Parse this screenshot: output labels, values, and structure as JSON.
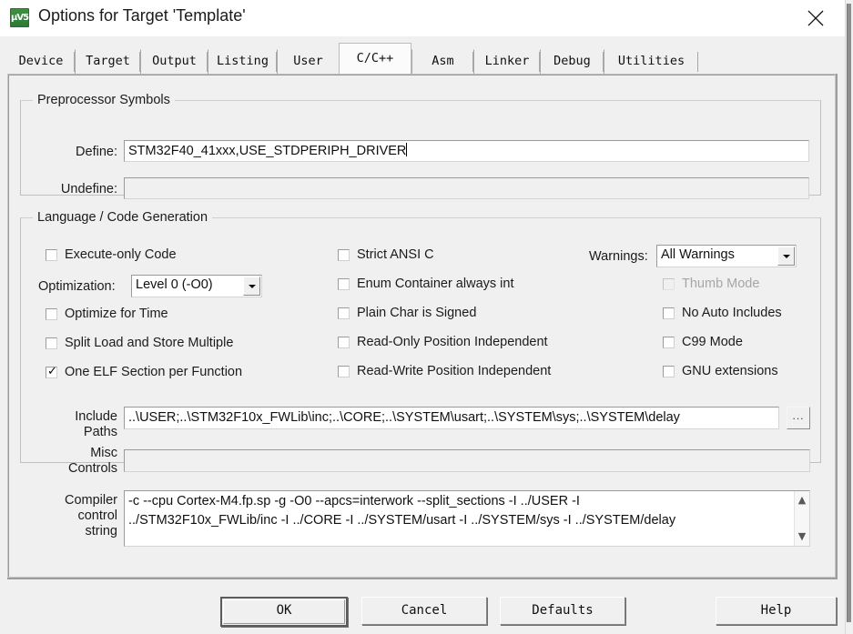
{
  "window": {
    "title": "Options for Target 'Template'",
    "icon": "uvision-logo-icon",
    "close_label": "✕"
  },
  "tabs": [
    {
      "label": "Device",
      "active": false
    },
    {
      "label": "Target",
      "active": false
    },
    {
      "label": "Output",
      "active": false
    },
    {
      "label": "Listing",
      "active": false
    },
    {
      "label": "User",
      "active": false
    },
    {
      "label": "C/C++",
      "active": true
    },
    {
      "label": "Asm",
      "active": false
    },
    {
      "label": "Linker",
      "active": false
    },
    {
      "label": "Debug",
      "active": false
    },
    {
      "label": "Utilities",
      "active": false
    }
  ],
  "preprocessor": {
    "group_title": "Preprocessor Symbols",
    "define_label": "Define:",
    "define_value": "STM32F40_41xxx,USE_STDPERIPH_DRIVER",
    "undefine_label": "Undefine:",
    "undefine_value": ""
  },
  "language": {
    "group_title": "Language / Code Generation",
    "col1": [
      {
        "label": "Execute-only Code",
        "checked": false,
        "disabled": false
      },
      {
        "label": "Optimize for Time",
        "checked": false,
        "disabled": false
      },
      {
        "label": "Split Load and Store Multiple",
        "checked": false,
        "disabled": false
      },
      {
        "label": "One ELF Section per Function",
        "checked": true,
        "disabled": false
      }
    ],
    "optimization_label": "Optimization:",
    "optimization_value": "Level 0 (-O0)",
    "col2": [
      {
        "label": "Strict ANSI C",
        "checked": false,
        "disabled": false
      },
      {
        "label": "Enum Container always int",
        "checked": false,
        "disabled": false
      },
      {
        "label": "Plain Char is Signed",
        "checked": false,
        "disabled": false
      },
      {
        "label": "Read-Only Position Independent",
        "checked": false,
        "disabled": false
      },
      {
        "label": "Read-Write Position Independent",
        "checked": false,
        "disabled": false
      }
    ],
    "warnings_label": "Warnings:",
    "warnings_value": "All Warnings",
    "col3": [
      {
        "label": "Thumb Mode",
        "checked": false,
        "disabled": true
      },
      {
        "label": "No Auto Includes",
        "checked": false,
        "disabled": false
      },
      {
        "label": "C99 Mode",
        "checked": false,
        "disabled": false
      },
      {
        "label": "GNU extensions",
        "checked": false,
        "disabled": false
      }
    ]
  },
  "paths": {
    "include_label_line1": "Include",
    "include_label_line2": "Paths",
    "include_value": "..\\USER;..\\STM32F10x_FWLib\\inc;..\\CORE;..\\SYSTEM\\usart;..\\SYSTEM\\sys;..\\SYSTEM\\delay",
    "browse_label": "...",
    "misc_label_line1": "Misc",
    "misc_label_line2": "Controls",
    "misc_value": ""
  },
  "compiler": {
    "label_line1": "Compiler",
    "label_line2": "control",
    "label_line3": "string",
    "line1": "-c --cpu Cortex-M4.fp.sp -g -O0 --apcs=interwork --split_sections -I ../USER -I",
    "line2": "../STM32F10x_FWLib/inc -I ../CORE -I ../SYSTEM/usart -I ../SYSTEM/sys -I ../SYSTEM/delay",
    "scroll_up_icon": "chevron-up-icon",
    "scroll_down_icon": "chevron-down-icon"
  },
  "buttons": {
    "ok": "OK",
    "cancel": "Cancel",
    "defaults": "Defaults",
    "help": "Help"
  },
  "colors": {
    "dialog_bg": "#f0f0f0",
    "field_bg": "#ffffff",
    "text": "#1b1b1b",
    "disabled_text": "#a6a6a6",
    "icon_green": "#3f8f44"
  }
}
